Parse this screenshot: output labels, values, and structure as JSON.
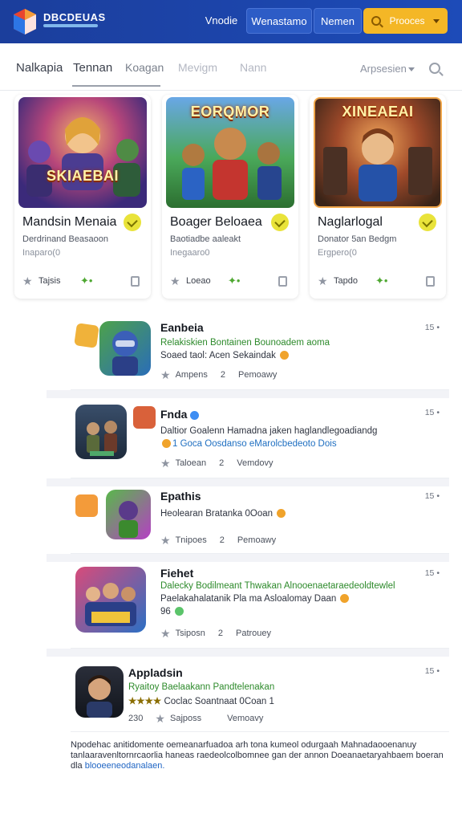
{
  "header": {
    "brand": "DBCDEUAS",
    "nav_plain": "Vnodie",
    "nav_b1": "Wenastamo",
    "nav_b2": "Nemen",
    "search_label": "Prooces"
  },
  "tabs": [
    {
      "label": "Nalkapia"
    },
    {
      "label": "Tennan"
    },
    {
      "label": "Koagan"
    },
    {
      "label": "Mevigm"
    },
    {
      "label": "Nann"
    }
  ],
  "sort_label": "Arpsesien",
  "cards": [
    {
      "thumb_text": "SKIAEBAI",
      "title": "Mandsin Menaia",
      "subtitle": "Derdrinand Beasaoon",
      "meta": "Inaparo(0",
      "foot": "Tajsis"
    },
    {
      "thumb_text": "EORQMOR",
      "title": "Boager Beloaea",
      "subtitle": "Baotiadbe aaleakt",
      "meta": "Inegaaro0",
      "foot": "Loeao"
    },
    {
      "thumb_text": "XINEAEAI",
      "title": "Naglarlogal",
      "subtitle": "Donator 5an Bedgm",
      "meta": "Ergpero(0",
      "foot": "Tapdo"
    }
  ],
  "rows": [
    {
      "title": "Eanbeia",
      "line1": "Relakiskien Bontainen Bounoadem aoma",
      "line2": "Soaed taol: Acen Sekaindak",
      "meta_a": "Ampens",
      "meta_num": "2",
      "meta_b": "Pemoawy",
      "count": "15 •"
    },
    {
      "title": "Fnda",
      "line1": "Daltior Goalenn Hamadna jaken haglandlegoadiandg",
      "line2": "1 Goca Oosdanso eMarolcbedeoto Dois",
      "meta_a": "Taloean",
      "meta_num": "2",
      "meta_b": "Vemdovy",
      "count": "15 •"
    },
    {
      "title": "Epathis",
      "line1": "Heolearan Bratanka 0Ooan",
      "line2": "",
      "meta_a": "Tnipoes",
      "meta_num": "2",
      "meta_b": "Pemoawy",
      "count": "15 •"
    },
    {
      "title": "Fiehet",
      "line1": "Dalecky Bodilmeant Thwakan Alnooenaetaraedeoldtewlel",
      "line2": "Paelakahalatanik Pla ma Asloalomay Daan",
      "line3": "96",
      "meta_a": "Tsiposn",
      "meta_num": "2",
      "meta_b": "Patrouey",
      "count": "15 •"
    },
    {
      "title": "Appladsin",
      "line1": "Ryaitoy Baelaakann Pandtelenakan",
      "line2": "Coclac Soantnaat 0Coan 1",
      "meta_a": "Sajposs",
      "meta_num": "230",
      "meta_b": "Vemoavy",
      "count": "15 •"
    }
  ],
  "footer_note": "Npodehac anitidomente oemeanarfuadoa arh tona kumeol odurgaah Mahnadaooenanuy tanlaaravenltornrcaorlia haneas raedeolcolbomnee gan der annon Doeanaetaryahbaem boeran dla",
  "footer_link": "blooeeneodanalaen."
}
